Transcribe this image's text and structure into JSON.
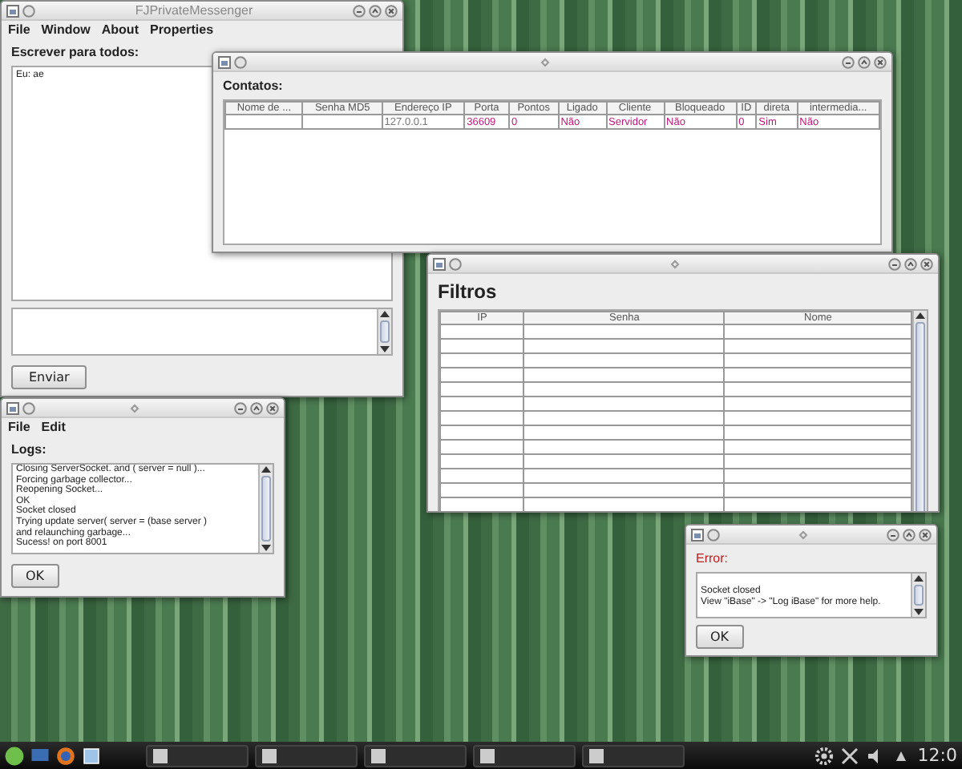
{
  "windows": [
    {
      "kind": "messenger",
      "title": "FJPrivateMessenger",
      "menu": [
        "File",
        "Window",
        "About",
        "Properties"
      ],
      "label": "Escrever para todos:",
      "messages": [
        "Eu: ae"
      ],
      "button": "Enviar"
    },
    {
      "kind": "contacts",
      "label": "Contatos:",
      "table": {
        "columns": [
          "Nome de ...",
          "Senha MD5",
          "Endereço IP",
          "Porta",
          "Pontos",
          "Ligado",
          "Cliente",
          "Bloqueado",
          "ID",
          "direta",
          "intermedia..."
        ],
        "rows": [
          [
            "",
            "",
            "127.0.0.1",
            "36609",
            "0",
            "Não",
            "Servidor",
            "Não",
            "0",
            "Sim",
            "Não"
          ]
        ]
      }
    },
    {
      "kind": "filters",
      "heading": "Filtros",
      "table": {
        "columns": [
          "IP",
          "Senha",
          "Nome"
        ]
      }
    },
    {
      "kind": "logs",
      "menu": [
        "File",
        "Edit"
      ],
      "label": "Logs:",
      "lines": [
        "Closing ServerSocket. and ( server = null )...",
        "Forcing garbage collector...",
        "Reopening Socket...",
        "OK",
        "Socket closed",
        "Trying update server( server = (base server )",
        "and relaunching garbage...",
        "Sucess! on port 8001"
      ],
      "button": "OK"
    },
    {
      "kind": "error",
      "label": "Error:",
      "lines": [
        "Socket closed",
        "View \"iBase\" -> \"Log iBase\" for more help."
      ],
      "button": "OK"
    }
  ],
  "taskbar": {
    "clock": "12:0"
  }
}
